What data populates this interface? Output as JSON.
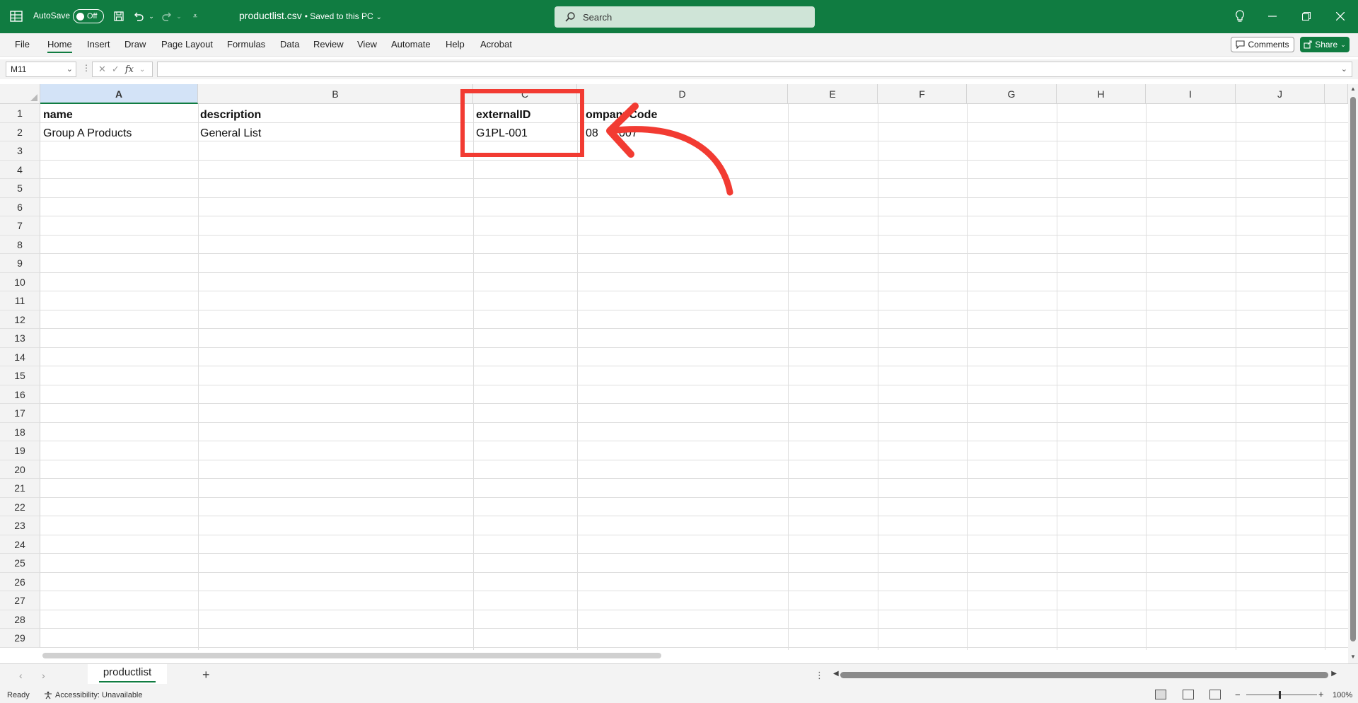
{
  "titlebar": {
    "autosave_label": "AutoSave",
    "toggle_state": "Off",
    "filename": "productlist.csv",
    "save_status": "• Saved to this PC",
    "search_placeholder": "Search",
    "bg_color": "#107c41"
  },
  "ribbon": {
    "tabs": [
      "File",
      "Home",
      "Insert",
      "Draw",
      "Page Layout",
      "Formulas",
      "Data",
      "Review",
      "View",
      "Automate",
      "Help",
      "Acrobat"
    ],
    "active_tab": "Home",
    "comments_label": "Comments",
    "share_label": "Share"
  },
  "formula_bar": {
    "name_box": "M11",
    "fx_label": "fx",
    "formula": ""
  },
  "grid": {
    "columns": [
      "A",
      "B",
      "C",
      "D",
      "E",
      "F",
      "G",
      "H",
      "I",
      "J"
    ],
    "selected_column": "A",
    "rows": [
      "1",
      "2",
      "3",
      "4",
      "5",
      "6",
      "7",
      "8",
      "9",
      "10",
      "11",
      "12",
      "13",
      "14",
      "15",
      "16",
      "17",
      "18",
      "19",
      "20",
      "21",
      "22",
      "23",
      "24",
      "25",
      "26",
      "27",
      "28",
      "29"
    ],
    "cells": {
      "A1": "name",
      "B1": "description",
      "C1": "externalID",
      "D1": "ompanyCode",
      "A2": "Group A Products",
      "B2": "General List",
      "C2": "G1PL-001",
      "D2": "08",
      "D2b": "007"
    },
    "annotation_color": "#f23b32"
  },
  "sheets": {
    "tabs": [
      "productlist"
    ],
    "active": "productlist"
  },
  "status": {
    "ready": "Ready",
    "accessibility": "Accessibility: Unavailable",
    "zoom": "100%"
  }
}
